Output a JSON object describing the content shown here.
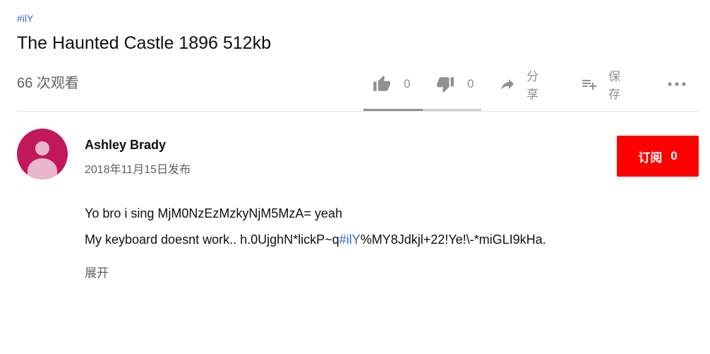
{
  "video": {
    "hashtag": "#ilY",
    "title": "The Haunted Castle 1896 512kb",
    "views": "66 次观看"
  },
  "actions": {
    "like_count": "0",
    "dislike_count": "0",
    "share_label": "分享",
    "save_label": "保存",
    "icons": [
      "thumbs-up-icon",
      "thumbs-down-icon",
      "share-arrow-icon",
      "playlist-add-icon",
      "more-horiz-icon"
    ],
    "like_ratio": 0.5
  },
  "channel": {
    "name": "Ashley Brady",
    "published": "2018年11月15日发布",
    "subscribe_label": "订阅",
    "subscriber_count": "0",
    "avatar_color": "#c2185b"
  },
  "description": {
    "line1": "Yo bro i sing MjM0NzEzMzkyNjM5MzA= yeah",
    "line2_pre": "My keyboard doesnt work.. h.0UjghN*lickP~q",
    "line2_tag": "#ilY",
    "line2_post": "%MY8Jdkjl+22!Ye!\\-*miGLI9kHa.",
    "show_more": "展开"
  },
  "colors": {
    "link": "#3366cc",
    "subscribe": "#ff0000",
    "muted_text": "#606060",
    "icon": "#909090"
  }
}
